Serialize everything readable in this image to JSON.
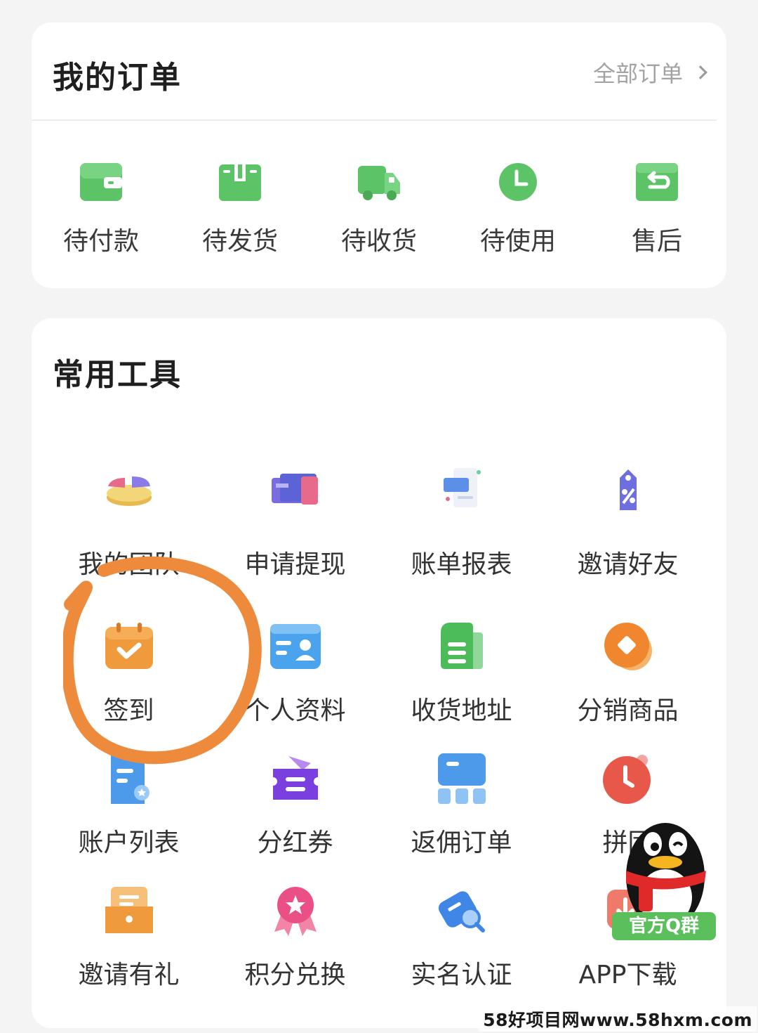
{
  "orders": {
    "title": "我的订单",
    "all_orders_label": "全部订单",
    "statuses": [
      {
        "label": "待付款",
        "icon": "wallet-icon"
      },
      {
        "label": "待发货",
        "icon": "package-box-icon"
      },
      {
        "label": "待收货",
        "icon": "delivery-truck-icon"
      },
      {
        "label": "待使用",
        "icon": "clock-icon"
      },
      {
        "label": "售后",
        "icon": "return-box-icon"
      }
    ]
  },
  "tools": {
    "title": "常用工具",
    "items": [
      {
        "label": "我的团队",
        "icon": "team-pie-chart-icon"
      },
      {
        "label": "申请提现",
        "icon": "cash-withdraw-icon"
      },
      {
        "label": "账单报表",
        "icon": "bill-report-icon"
      },
      {
        "label": "邀请好友",
        "icon": "invite-tag-icon"
      },
      {
        "label": "签到",
        "icon": "calendar-check-icon"
      },
      {
        "label": "个人资料",
        "icon": "profile-card-icon"
      },
      {
        "label": "收货地址",
        "icon": "address-document-icon"
      },
      {
        "label": "分销商品",
        "icon": "distribution-coin-icon"
      },
      {
        "label": "账户列表",
        "icon": "account-list-icon"
      },
      {
        "label": "分红券",
        "icon": "coupon-icon"
      },
      {
        "label": "返佣订单",
        "icon": "rebate-order-icon"
      },
      {
        "label": "拼团",
        "icon": "group-clock-icon"
      },
      {
        "label": "邀请有礼",
        "icon": "gift-box-icon"
      },
      {
        "label": "积分兑换",
        "icon": "points-medal-icon"
      },
      {
        "label": "实名认证",
        "icon": "verify-search-icon"
      },
      {
        "label": "APP下载",
        "icon": "app-download-icon"
      }
    ]
  },
  "overlay": {
    "qq_group_label": "官方Q群",
    "watermark": "58好项目网www.58hxm.com"
  },
  "colors": {
    "order_icon_green": "#5cc466",
    "annotation_orange": "#ee8a3c",
    "card_background": "#ffffff",
    "page_background": "#f4f4f5"
  }
}
